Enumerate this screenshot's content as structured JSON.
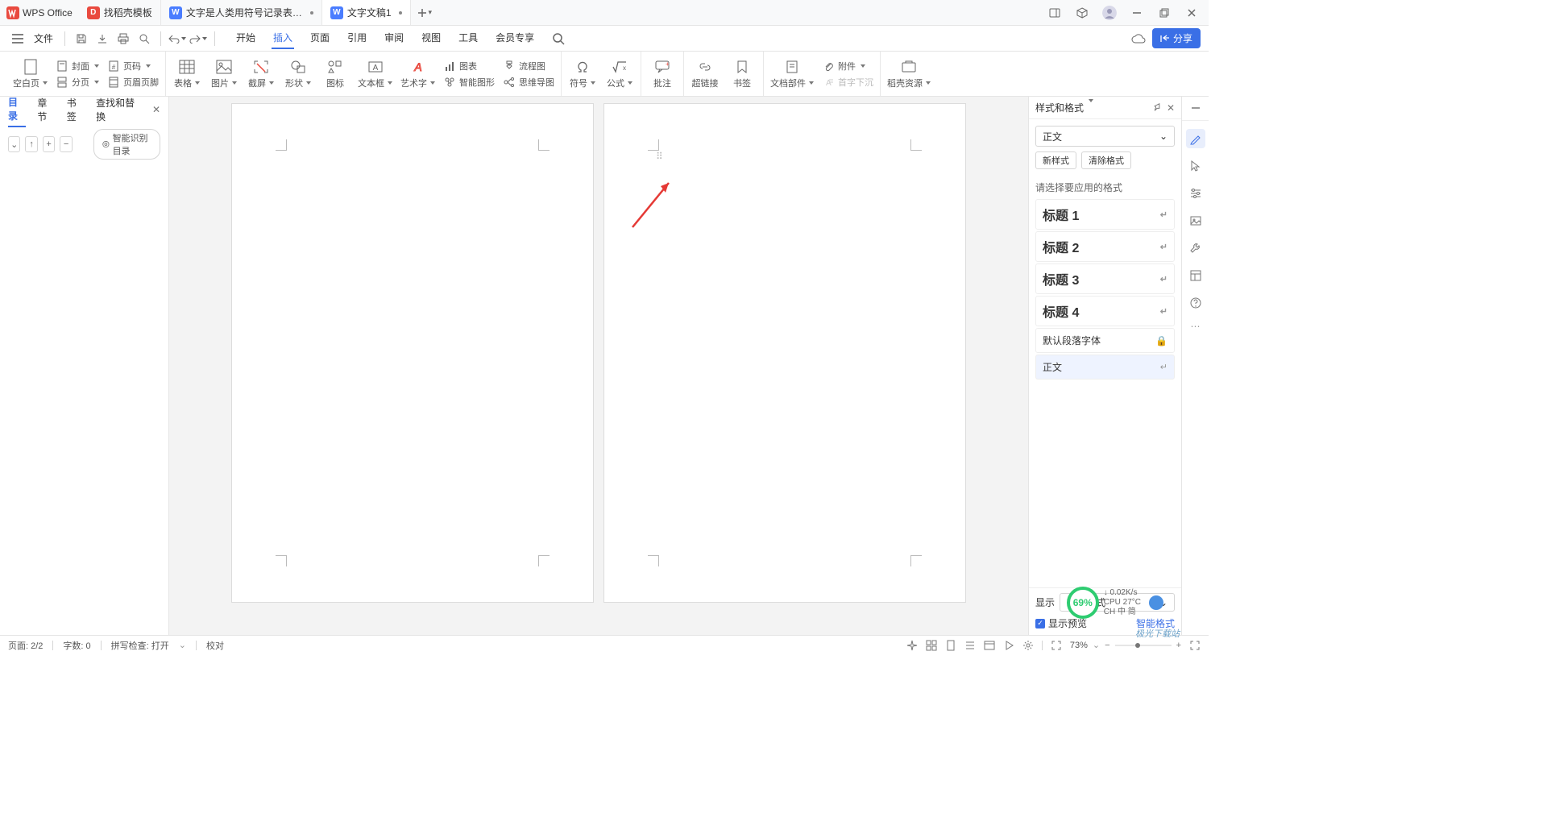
{
  "app_name": "WPS Office",
  "tabs": [
    {
      "label": "找稻壳模板"
    },
    {
      "label": "文字是人类用符号记录表达信息以"
    },
    {
      "label": "文字文稿1"
    }
  ],
  "file_menu_label": "文件",
  "main_menus": [
    "开始",
    "插入",
    "页面",
    "引用",
    "审阅",
    "视图",
    "工具",
    "会员专享"
  ],
  "active_menu_index": 1,
  "share_button": "分享",
  "ribbon": {
    "blank_page": "空白页",
    "cover": "封面",
    "page_number": "页码",
    "page_break": "分页",
    "header_footer": "页眉页脚",
    "table": "表格",
    "picture": "图片",
    "screenshot": "截屏",
    "shape": "形状",
    "icon": "图标",
    "text_box": "文本框",
    "word_art": "艺术字",
    "chart": "图表",
    "flowchart": "流程图",
    "smart_art": "智能图形",
    "mind_map": "思维导图",
    "symbol": "符号",
    "equation": "公式",
    "comment": "批注",
    "hyperlink": "超链接",
    "bookmark": "书签",
    "doc_parts": "文档部件",
    "attachment": "附件",
    "drop_cap": "首字下沉",
    "dk_resources": "稻壳资源"
  },
  "nav_panel": {
    "tabs": [
      "目录",
      "章节",
      "书签",
      "查找和替换"
    ],
    "active_tab_index": 0,
    "smart_toc": "智能识别目录"
  },
  "style_pane": {
    "title": "样式和格式",
    "current_style": "正文",
    "new_style_btn": "新样式",
    "clear_format_btn": "清除格式",
    "section_label": "请选择要应用的格式",
    "styles": [
      {
        "name": "标题 1",
        "mark": "↵"
      },
      {
        "name": "标题 2",
        "mark": "↵"
      },
      {
        "name": "标题 3",
        "mark": "↵"
      },
      {
        "name": "标题 4",
        "mark": "↵"
      }
    ],
    "default_font": "默认段落字体",
    "body_text": "正文",
    "display_label": "显示",
    "display_value": "有效样式",
    "smart_format": "智能格式",
    "show_preview": "显示预览"
  },
  "statusbar": {
    "page": "页面: 2/2",
    "words": "字数: 0",
    "spellcheck": "拼写检查: 打开",
    "proof": "校对",
    "zoom": "73%"
  },
  "hud": {
    "percent": "69%",
    "net": "0.02K/s",
    "cpu": "CPU 27°C",
    "ime": "CH 中 简"
  },
  "watermark": "极光下载站"
}
